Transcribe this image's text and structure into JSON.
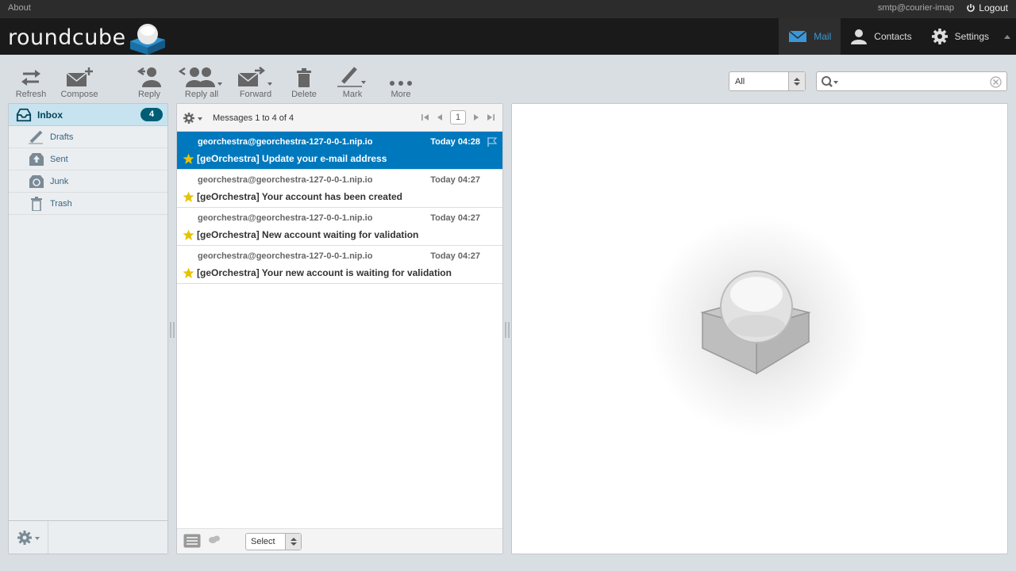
{
  "topline": {
    "about": "About",
    "user": "smtp@courier-imap",
    "logout": "Logout"
  },
  "header": {
    "logo_text": "roundcube",
    "tasks": [
      {
        "label": "Mail",
        "icon": "mail-icon",
        "active": true
      },
      {
        "label": "Contacts",
        "icon": "contacts-icon",
        "active": false
      },
      {
        "label": "Settings",
        "icon": "settings-gear-icon",
        "active": false
      }
    ]
  },
  "toolbar": {
    "refresh": "Refresh",
    "compose": "Compose",
    "reply": "Reply",
    "reply_all": "Reply all",
    "forward": "Forward",
    "delete": "Delete",
    "mark": "Mark",
    "more": "More"
  },
  "filter": {
    "value": "All"
  },
  "search": {
    "value": "",
    "placeholder": ""
  },
  "folders": [
    {
      "name": "Inbox",
      "count": "4",
      "icon": "inbox-icon"
    },
    {
      "name": "Drafts",
      "icon": "drafts-pencil-icon"
    },
    {
      "name": "Sent",
      "icon": "sent-icon"
    },
    {
      "name": "Junk",
      "icon": "junk-icon"
    },
    {
      "name": "Trash",
      "icon": "trash-icon"
    }
  ],
  "messagelist": {
    "count_text": "Messages 1 to 4 of 4",
    "page": "1",
    "select_label": "Select",
    "messages": [
      {
        "from": "georchestra@georchestra-127-0-0-1.nip.io",
        "date": "Today 04:28",
        "subject": "[geOrchestra] Update your e-mail address",
        "selected": true
      },
      {
        "from": "georchestra@georchestra-127-0-0-1.nip.io",
        "date": "Today 04:27",
        "subject": "[geOrchestra] Your account has been created",
        "selected": false
      },
      {
        "from": "georchestra@georchestra-127-0-0-1.nip.io",
        "date": "Today 04:27",
        "subject": "[geOrchestra] New account waiting for validation",
        "selected": false
      },
      {
        "from": "georchestra@georchestra-127-0-0-1.nip.io",
        "date": "Today 04:27",
        "subject": "[geOrchestra] Your new account is waiting for validation",
        "selected": false
      }
    ]
  },
  "colors": {
    "selected_row": "#0078bd",
    "accent": "#3a98d8",
    "unread_badge": "#005d76",
    "star": "#e6c300"
  }
}
